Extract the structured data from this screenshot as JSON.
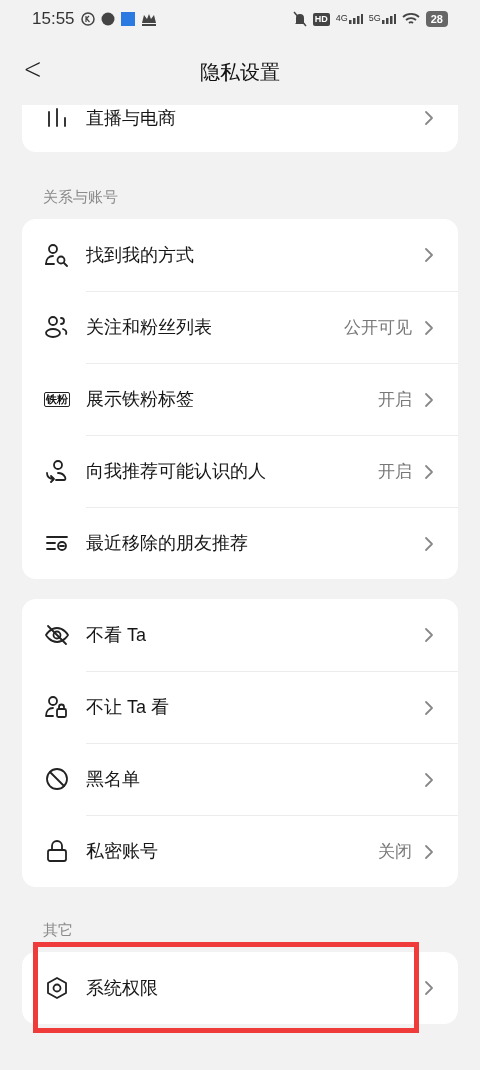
{
  "status_bar": {
    "time": "15:55",
    "network_1": "4G",
    "network_2": "5G",
    "battery": "28",
    "hd": "HD"
  },
  "header": {
    "back": "<",
    "title": "隐私设置"
  },
  "sections": [
    {
      "items": [
        {
          "text": "直播与电商",
          "highlighted": false
        }
      ]
    },
    {
      "label": "关系与账号",
      "items": [
        {
          "text": "找到我的方式",
          "highlighted": false
        },
        {
          "text": "关注和粉丝列表",
          "value": "公开可见",
          "highlighted": false
        },
        {
          "icon_text": "铁粉",
          "text": "展示铁粉标签",
          "value": "开启",
          "highlighted": false
        },
        {
          "text": "向我推荐可能认识的人",
          "value": "开启",
          "highlighted": false
        },
        {
          "text": "最近移除的朋友推荐",
          "highlighted": false
        }
      ]
    },
    {
      "items": [
        {
          "text": "不看 Ta",
          "highlighted": false
        },
        {
          "text": "不让 Ta 看",
          "highlighted": false
        },
        {
          "text": "黑名单",
          "highlighted": false
        },
        {
          "text": "私密账号",
          "value": "关闭",
          "highlighted": false
        }
      ]
    },
    {
      "label": "其它",
      "items": [
        {
          "text": "系统权限",
          "highlighted": true
        }
      ]
    }
  ]
}
